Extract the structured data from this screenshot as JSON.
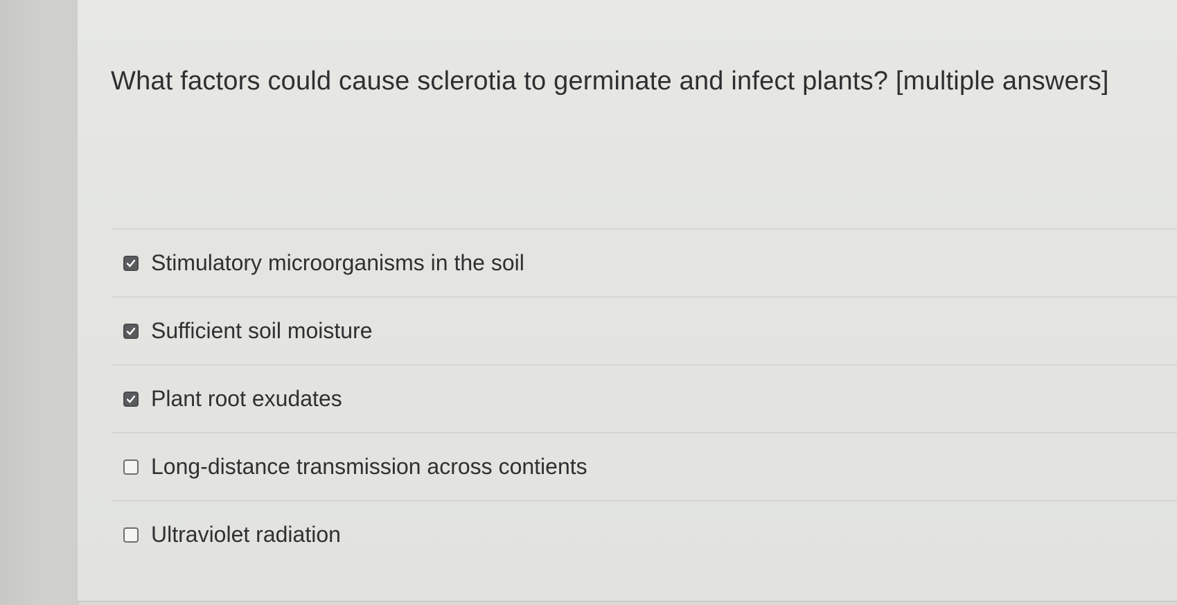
{
  "question": {
    "text": "What factors could cause sclerotia to germinate and infect plants? [multiple answers]"
  },
  "answers": [
    {
      "label": "Stimulatory microorganisms in the soil",
      "checked": true
    },
    {
      "label": "Sufficient soil moisture",
      "checked": true
    },
    {
      "label": "Plant root exudates",
      "checked": true
    },
    {
      "label": "Long-distance transmission across contients",
      "checked": false
    },
    {
      "label": "Ultraviolet radiation",
      "checked": false
    }
  ],
  "icons": {
    "checked": "checkmark-icon"
  }
}
